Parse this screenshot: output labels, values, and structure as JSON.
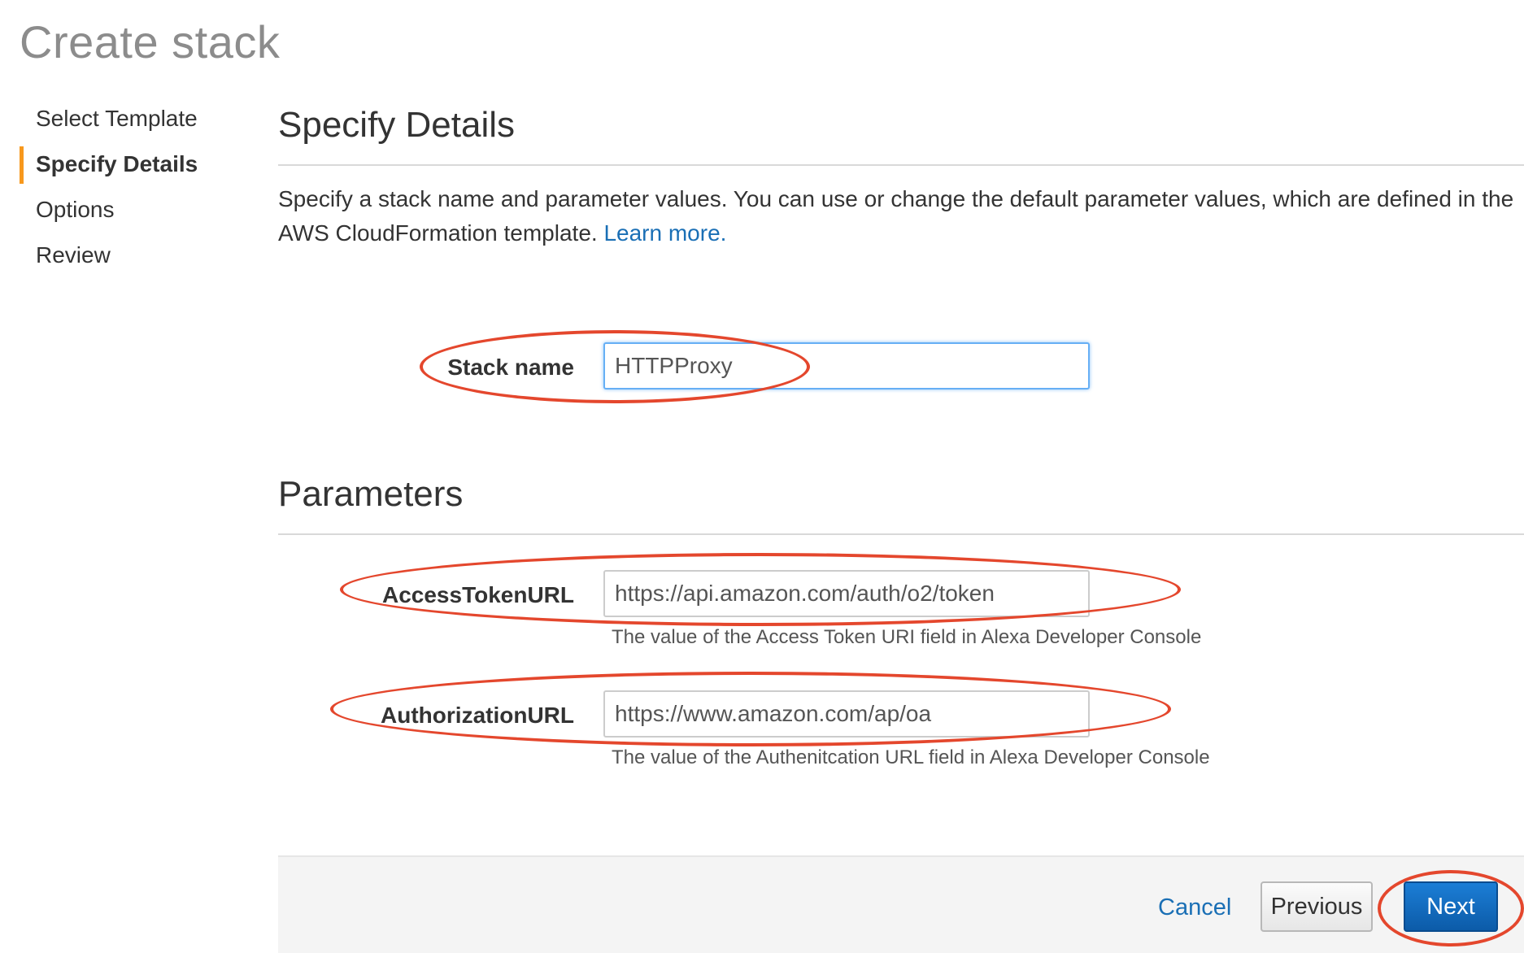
{
  "page": {
    "title": "Create stack"
  },
  "steps": [
    {
      "label": "Select Template",
      "active": false
    },
    {
      "label": "Specify Details",
      "active": true
    },
    {
      "label": "Options",
      "active": false
    },
    {
      "label": "Review",
      "active": false
    }
  ],
  "details": {
    "heading": "Specify Details",
    "description": "Specify a stack name and parameter values. You can use or change the default parameter values, which are defined in the AWS CloudFormation template.",
    "learn_more": "Learn more."
  },
  "stack_name": {
    "label": "Stack name",
    "value": "HTTPProxy"
  },
  "parameters": {
    "heading": "Parameters",
    "access_token_url": {
      "label": "AccessTokenURL",
      "value": "https://api.amazon.com/auth/o2/token",
      "hint": "The value of the Access Token URI field in Alexa Developer Console"
    },
    "authorization_url": {
      "label": "AuthorizationURL",
      "value": "https://www.amazon.com/ap/oa",
      "hint": "The value of the Authenitcation URL field in Alexa Developer Console"
    }
  },
  "footer": {
    "cancel": "Cancel",
    "previous": "Previous",
    "next": "Next"
  },
  "colors": {
    "accent": "#f7981d",
    "link": "#1a6fb5",
    "primary_button": "#0c5ba8",
    "annotation": "#e4472d"
  }
}
